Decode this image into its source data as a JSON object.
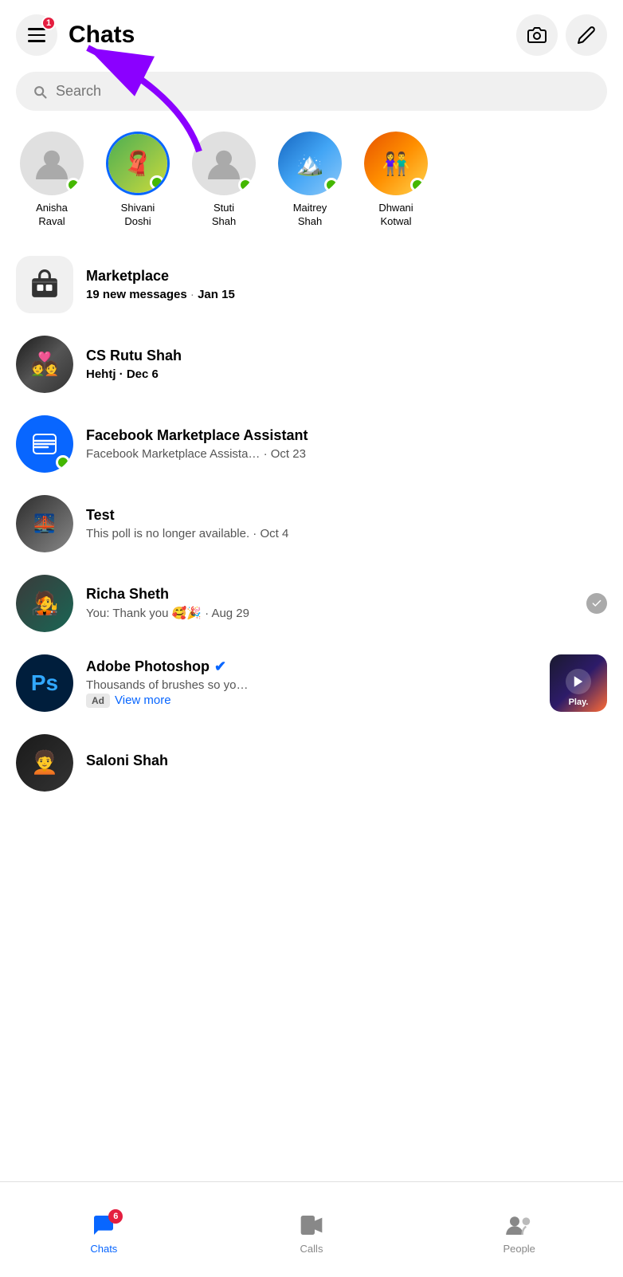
{
  "header": {
    "title": "Chats",
    "menu_badge": "1",
    "camera_label": "camera",
    "edit_label": "edit"
  },
  "search": {
    "placeholder": "Search"
  },
  "stories": [
    {
      "id": "anisha",
      "name": "Anisha\nRaval",
      "online": true,
      "has_image": false
    },
    {
      "id": "shivani",
      "name": "Shivani\nDoshi",
      "online": true,
      "has_image": true
    },
    {
      "id": "stuti",
      "name": "Stuti\nShah",
      "online": true,
      "has_image": false
    },
    {
      "id": "maitrey",
      "name": "Maitrey\nShah",
      "online": true,
      "has_image": true
    },
    {
      "id": "dhwani",
      "name": "Dhwani\nKotwal",
      "online": true,
      "has_image": true
    }
  ],
  "chats": [
    {
      "id": "marketplace",
      "name": "Marketplace",
      "preview": "19 new messages",
      "date": "Jan 15",
      "type": "marketplace",
      "bold": true,
      "online": false
    },
    {
      "id": "cs-rutu",
      "name": "CS Rutu Shah",
      "preview": "Hehtj · Dec 6",
      "date": "",
      "type": "person",
      "bold": true,
      "online": false
    },
    {
      "id": "fb-marketplace",
      "name": "Facebook Marketplace Assistant",
      "preview": "Facebook Marketplace Assista… · Oct 23",
      "date": "",
      "type": "marketplace-blue",
      "bold": false,
      "online": true
    },
    {
      "id": "test",
      "name": "Test",
      "preview": "This poll is no longer available. · Oct 4",
      "date": "",
      "type": "person",
      "bold": false,
      "online": false
    },
    {
      "id": "richa",
      "name": "Richa Sheth",
      "preview": "You: Thank you 🥰🎉 · Aug 29",
      "date": "",
      "type": "person",
      "bold": false,
      "online": false,
      "checkmark": true
    },
    {
      "id": "adobe",
      "name": "Adobe Photoshop",
      "preview": "Thousands of brushes so yo…",
      "date": "",
      "type": "ad",
      "bold": false,
      "online": false,
      "verified": true,
      "ad": true,
      "ad_label": "Ad",
      "ad_view_more": "View more"
    },
    {
      "id": "saloni",
      "name": "Saloni Shah",
      "preview": "",
      "date": "",
      "type": "person",
      "bold": false,
      "online": false
    }
  ],
  "bottom_nav": {
    "items": [
      {
        "id": "chats",
        "label": "Chats",
        "active": true,
        "badge": "6"
      },
      {
        "id": "calls",
        "label": "Calls",
        "active": false,
        "badge": ""
      },
      {
        "id": "people",
        "label": "People",
        "active": false,
        "badge": ""
      }
    ]
  }
}
